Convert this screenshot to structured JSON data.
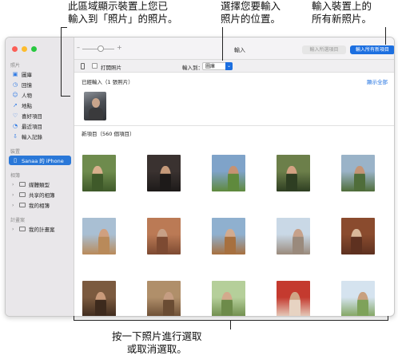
{
  "callouts": {
    "left_line1": "此區域顯示裝置上您已",
    "left_line2": "輸入到「照片」的照片。",
    "mid_line1": "選擇您要輸入",
    "mid_line2": "照片的位置。",
    "right_line1": "輸入裝置上的",
    "right_line2": "所有新照片。",
    "bottom_line1": "按一下照片進行選取",
    "bottom_line2": "或取消選取。"
  },
  "sidebar": {
    "section_photos": "照片",
    "items": [
      {
        "label": "圖庫",
        "icon": "library-icon"
      },
      {
        "label": "回憶",
        "icon": "memories-icon"
      },
      {
        "label": "人物",
        "icon": "people-icon"
      },
      {
        "label": "地點",
        "icon": "places-icon"
      },
      {
        "label": "喜好項目",
        "icon": "favorites-icon"
      },
      {
        "label": "最近項目",
        "icon": "recents-icon"
      },
      {
        "label": "輸入記錄",
        "icon": "imports-icon"
      }
    ],
    "section_devices": "裝置",
    "device": "Sanaa 的 iPhone",
    "section_albums": "相簿",
    "albums": [
      "媒體類型",
      "共享的相簿",
      "我的相簿"
    ],
    "section_projects": "計畫案",
    "projects": [
      "我的計畫案"
    ]
  },
  "toolbar": {
    "title": "輸入",
    "import_selected": "輸入所選項目",
    "import_all": "輸入所有新項目"
  },
  "subbar": {
    "open_photos": "打開照片",
    "import_to_label": "輸入到：",
    "import_to_value": "圖庫"
  },
  "content": {
    "already_imported": "已經輸入（1 張照片）",
    "show_all": "顯示全部",
    "new_items": "新項目（560 個項目）"
  },
  "colors": {
    "accent": "#1c6fe0",
    "sidebar_bg": "#e9e7ea",
    "selected_bg": "#2a78d8"
  }
}
